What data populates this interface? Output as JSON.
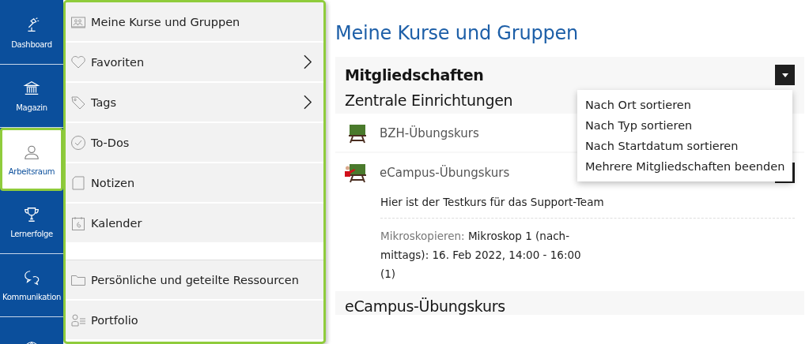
{
  "rail": [
    {
      "label": "Dashboard",
      "selected": false
    },
    {
      "label": "Magazin",
      "selected": false
    },
    {
      "label": "Arbeitsraum",
      "selected": true
    },
    {
      "label": "Lernerfolge",
      "selected": false
    },
    {
      "label": "Kommunikation",
      "selected": false
    },
    {
      "selected": false
    }
  ],
  "submenu": {
    "groups": [
      [
        {
          "label": "Meine Kurse und Gruppen",
          "submenu": false
        },
        {
          "label": "Favoriten",
          "submenu": true
        },
        {
          "label": "Tags",
          "submenu": true
        },
        {
          "label": "To-Dos",
          "submenu": false
        },
        {
          "label": "Notizen",
          "submenu": false
        },
        {
          "label": "Kalender",
          "submenu": false
        }
      ],
      [
        {
          "label": "Persönliche und geteilte Ressourcen",
          "submenu": false
        },
        {
          "label": "Portfolio",
          "submenu": false
        }
      ]
    ]
  },
  "page_title": "Meine Kurse und Gruppen",
  "panel": {
    "title": "Mitgliedschaften",
    "menu": [
      "Nach Ort sortieren",
      "Nach Typ sortieren",
      "Nach Startdatum sortieren",
      "Mehrere Mitgliedschaften beenden"
    ],
    "sections": [
      {
        "title": "Zentrale Einrichtungen",
        "items": [
          {
            "title": "BZH-Übungskurs",
            "kind": "course"
          },
          {
            "title": "eCampus-Übungskurs",
            "kind": "course-admin",
            "description": "Hier ist der Testkurs für das Support-Team",
            "property_label": "Mikroskopieren:",
            "property_lines": [
              "Mikroskop 1 (nach-",
              "mittags): 16. Feb 2022, 14:00 - 16:00",
              "(1)"
            ]
          }
        ]
      },
      {
        "title": "eCampus-Übungskurs"
      }
    ]
  }
}
